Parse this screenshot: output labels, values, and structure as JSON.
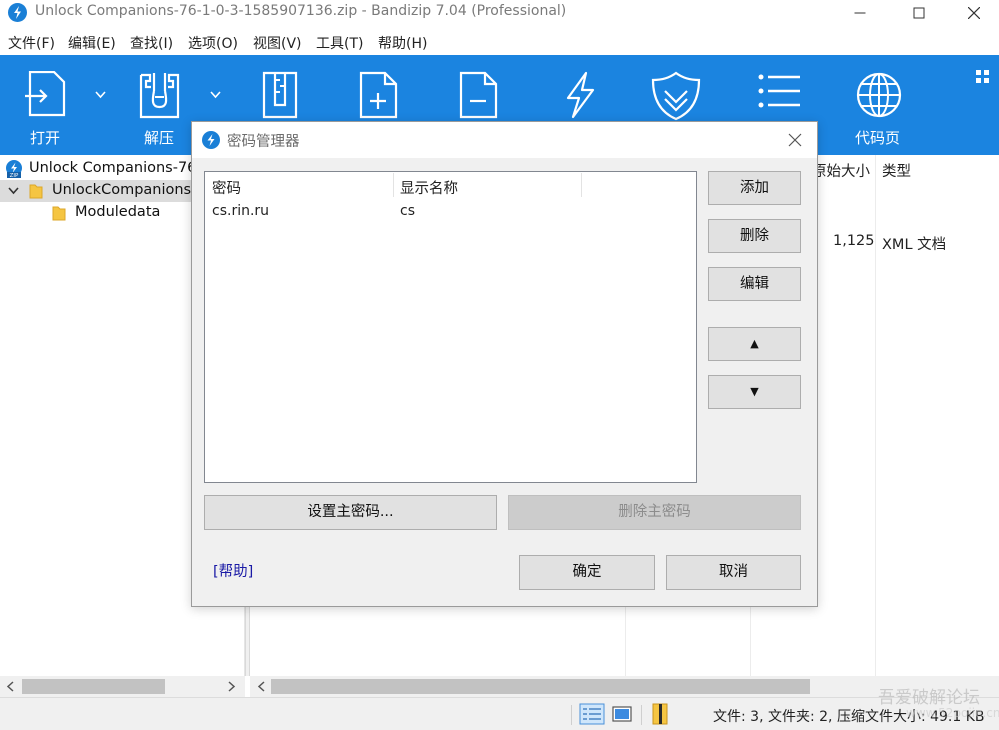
{
  "window": {
    "title": "Unlock Companions-76-1-0-3-1585907136.zip - Bandizip 7.04 (Professional)"
  },
  "menu": [
    "文件(F)",
    "编辑(E)",
    "查找(I)",
    "选项(O)",
    "视图(V)",
    "工具(T)",
    "帮助(H)"
  ],
  "toolbar": {
    "open": "打开",
    "extract": "解压",
    "codepage": "代码页"
  },
  "tree": {
    "root": "Unlock Companions-76-",
    "folder": "UnlockCompanions",
    "subfolder": "Moduledata"
  },
  "list": {
    "col_size": "原始大小",
    "col_type": "类型",
    "row_size": "1,125",
    "row_type": "XML 文档"
  },
  "status": {
    "text": "文件: 3, 文件夹: 2, 压缩文件大小: 49.1 KB",
    "watermark": "吾爱破解论坛",
    "watermark_url": "www.52pojie.cn"
  },
  "dialog": {
    "title": "密码管理器",
    "columns": [
      "密码",
      "显示名称"
    ],
    "rows": [
      {
        "password": "cs.rin.ru",
        "display_name": "cs"
      }
    ],
    "buttons": {
      "add": "添加",
      "delete": "删除",
      "edit": "编辑",
      "up": "▲",
      "down": "▼",
      "set_master": "设置主密码...",
      "remove_master": "删除主密码",
      "ok": "确定",
      "cancel": "取消"
    },
    "help": "[帮助]"
  },
  "colors": {
    "toolbar_bg": "#1b84e0",
    "dialog_bg": "#f0f0f0",
    "link": "#1a1aa6"
  }
}
